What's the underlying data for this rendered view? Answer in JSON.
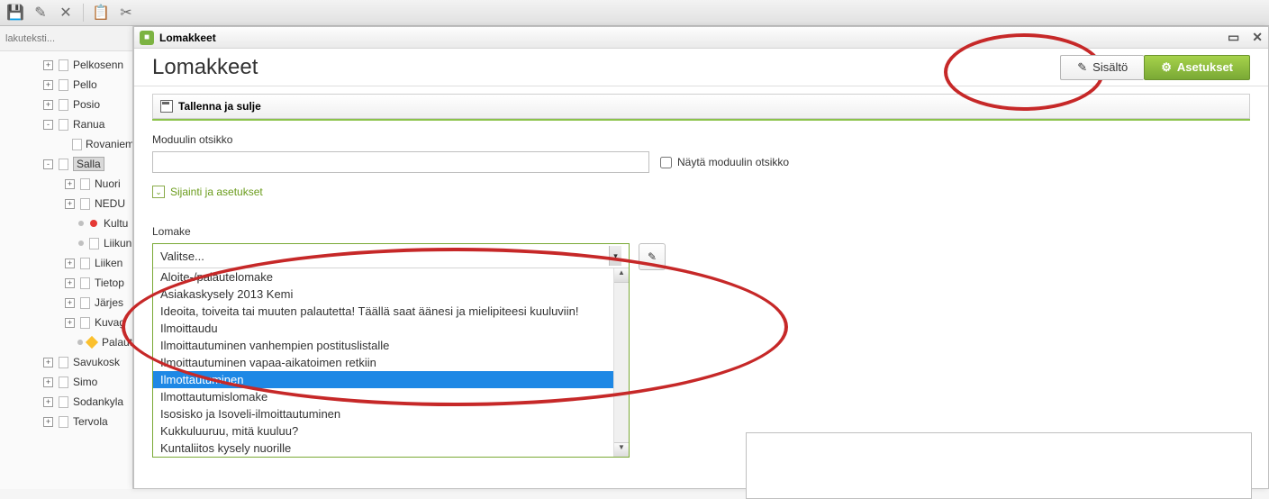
{
  "search_placeholder": "lakuteksti...",
  "tree": [
    {
      "label": "Pelkosenn",
      "exp": "+",
      "lvl": 1
    },
    {
      "label": "Pello",
      "exp": "+",
      "lvl": 1
    },
    {
      "label": "Posio",
      "exp": "+",
      "lvl": 1
    },
    {
      "label": "Ranua",
      "exp": "-",
      "lvl": 1
    },
    {
      "label": "Rovaniem",
      "exp": "",
      "lvl": 2,
      "dot": true
    },
    {
      "label": "Salla",
      "exp": "-",
      "lvl": 1,
      "sel": true
    },
    {
      "label": "Nuori",
      "exp": "+",
      "lvl": 2
    },
    {
      "label": "NEDU",
      "exp": "+",
      "lvl": 2
    },
    {
      "label": "Kultu",
      "exp": "",
      "lvl": 2,
      "dot": true,
      "red": true
    },
    {
      "label": "Liikun",
      "exp": "",
      "lvl": 2,
      "dot": true
    },
    {
      "label": "Liiken",
      "exp": "+",
      "lvl": 2
    },
    {
      "label": "Tietop",
      "exp": "+",
      "lvl": 2
    },
    {
      "label": "Järjes",
      "exp": "+",
      "lvl": 2
    },
    {
      "label": "Kuvag",
      "exp": "+",
      "lvl": 2
    },
    {
      "label": "Palaut",
      "exp": "",
      "lvl": 2,
      "dot": true,
      "warn": true
    },
    {
      "label": "Savukosk",
      "exp": "+",
      "lvl": 1
    },
    {
      "label": "Simo",
      "exp": "+",
      "lvl": 1
    },
    {
      "label": "Sodankyla",
      "exp": "+",
      "lvl": 1
    },
    {
      "label": "Tervola",
      "exp": "+",
      "lvl": 1
    }
  ],
  "dialog": {
    "title": "Lomakkeet",
    "page_title": "Lomakkeet",
    "tab_content": "Sisältö",
    "tab_settings": "Asetukset",
    "save_label": "Tallenna ja sulje",
    "module_title_label": "Moduulin otsikko",
    "show_module_title": "Näytä moduulin otsikko",
    "location_settings": "Sijainti ja asetukset",
    "lomake_label": "Lomake",
    "select_placeholder": "Valitse...",
    "options": [
      "Aloite-/palautelomake",
      "Asiakaskysely 2013 Kemi",
      "Ideoita, toiveita tai muuten palautetta! Täällä saat äänesi ja mielipiteesi kuuluviin!",
      "Ilmoittaudu",
      "Ilmoittautuminen vanhempien postituslistalle",
      "Ilmoittautuminen vapaa-aikatoimen retkiin",
      "Ilmottautuminen",
      "Ilmottautumislomake",
      "Isosisko ja Isoveli-ilmoittautuminen",
      "Kukkuluuruu, mitä kuuluu?",
      "Kuntaliitos kysely nuorille"
    ],
    "selected_index": 6
  }
}
